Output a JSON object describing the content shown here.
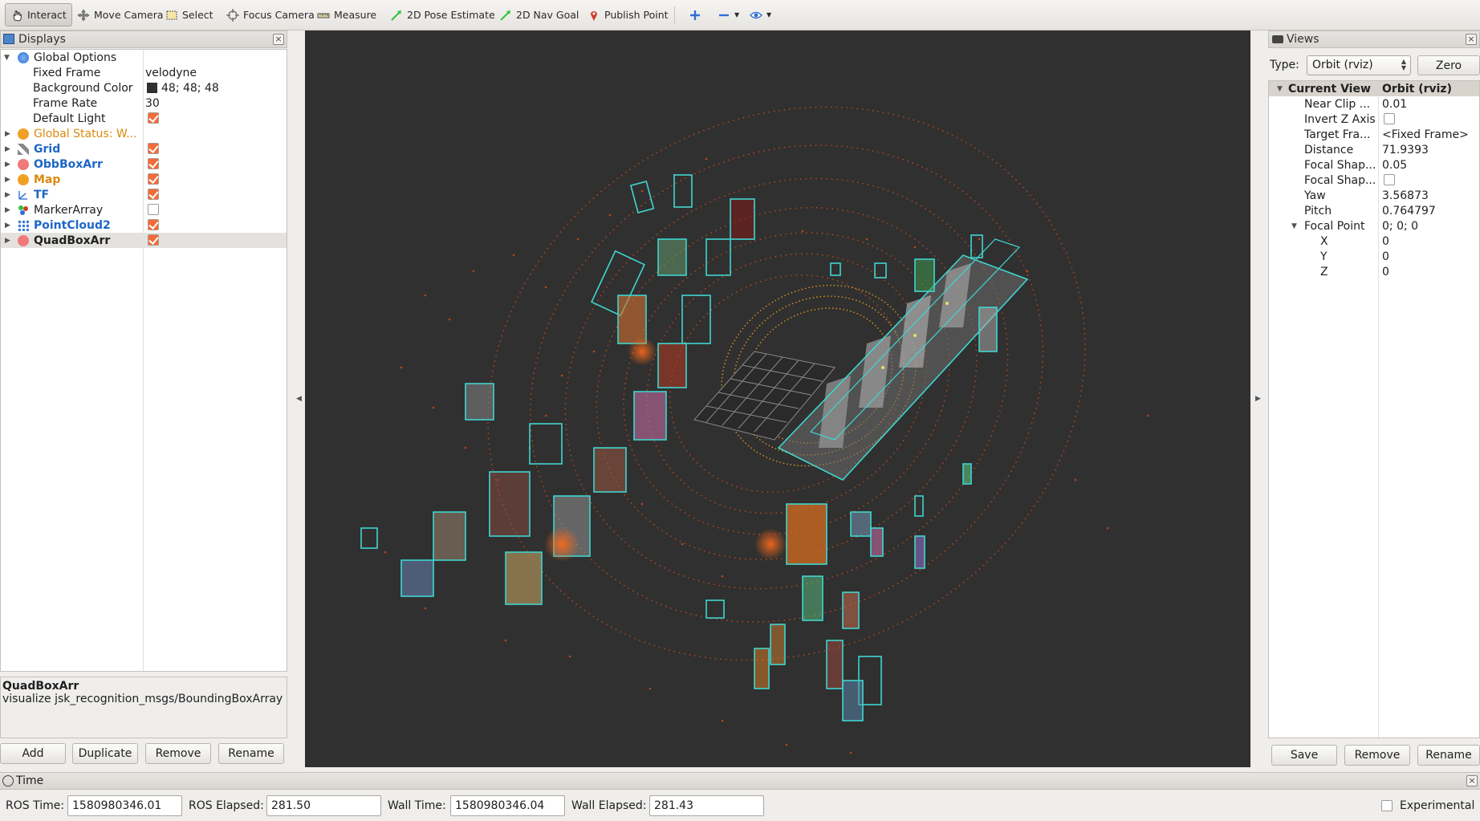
{
  "toolbar": {
    "interact": "Interact",
    "move_camera": "Move Camera",
    "select": "Select",
    "focus_camera": "Focus Camera",
    "measure": "Measure",
    "pose_estimate": "2D Pose Estimate",
    "nav_goal": "2D Nav Goal",
    "publish_point": "Publish Point"
  },
  "displays": {
    "title": "Displays",
    "rows": [
      {
        "label": "Global Options",
        "value": ""
      },
      {
        "label": "Fixed Frame",
        "value": "velodyne"
      },
      {
        "label": "Background Color",
        "value": "48; 48; 48"
      },
      {
        "label": "Frame Rate",
        "value": "30"
      },
      {
        "label": "Default Light",
        "value": ""
      },
      {
        "label": "Global Status: W...",
        "value": ""
      },
      {
        "label": "Grid",
        "value": ""
      },
      {
        "label": "ObbBoxArr",
        "value": ""
      },
      {
        "label": "Map",
        "value": ""
      },
      {
        "label": "TF",
        "value": ""
      },
      {
        "label": "MarkerArray",
        "value": ""
      },
      {
        "label": "PointCloud2",
        "value": ""
      },
      {
        "label": "QuadBoxArr",
        "value": ""
      }
    ],
    "description_title": "QuadBoxArr",
    "description_text": "visualize jsk_recognition_msgs/BoundingBoxArray",
    "buttons": {
      "add": "Add",
      "duplicate": "Duplicate",
      "remove": "Remove",
      "rename": "Rename"
    }
  },
  "views": {
    "title": "Views",
    "type_label": "Type:",
    "type_value": "Orbit (rviz)",
    "zero_button": "Zero",
    "rows": [
      {
        "label": "Current View",
        "value": "Orbit (rviz)"
      },
      {
        "label": "Near Clip ...",
        "value": "0.01"
      },
      {
        "label": "Invert Z Axis",
        "value": ""
      },
      {
        "label": "Target Fra...",
        "value": "<Fixed Frame>"
      },
      {
        "label": "Distance",
        "value": "71.9393"
      },
      {
        "label": "Focal Shap...",
        "value": "0.05"
      },
      {
        "label": "Focal Shap...",
        "value": ""
      },
      {
        "label": "Yaw",
        "value": "3.56873"
      },
      {
        "label": "Pitch",
        "value": "0.764797"
      },
      {
        "label": "Focal Point",
        "value": "0; 0; 0"
      },
      {
        "label": "X",
        "value": "0"
      },
      {
        "label": "Y",
        "value": "0"
      },
      {
        "label": "Z",
        "value": "0"
      }
    ],
    "buttons": {
      "save": "Save",
      "remove": "Remove",
      "rename": "Rename"
    }
  },
  "time": {
    "title": "Time",
    "ros_time_label": "ROS Time:",
    "ros_time": "1580980346.01",
    "ros_elapsed_label": "ROS Elapsed:",
    "ros_elapsed": "281.50",
    "wall_time_label": "Wall Time:",
    "wall_time": "1580980346.04",
    "wall_elapsed_label": "Wall Elapsed:",
    "wall_elapsed": "281.43",
    "experimental_label": "Experimental"
  },
  "colors": {
    "background": "#303030",
    "box_outline": "#3fd6d0",
    "check_on": "#f36b3a"
  }
}
